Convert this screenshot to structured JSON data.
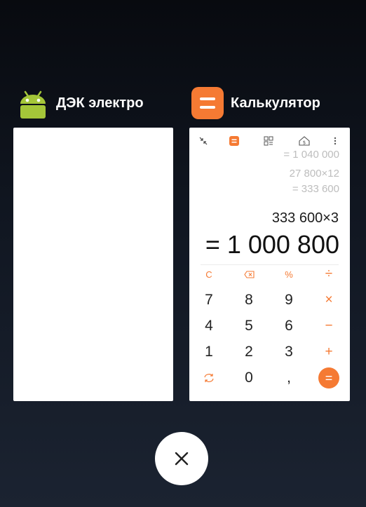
{
  "recents": [
    {
      "app_name": "ДЭК электро",
      "icon": "android-icon"
    },
    {
      "app_name": "Калькулятор",
      "icon": "calculator-icon",
      "calculator": {
        "toolbar": [
          "collapse-icon",
          "calculator-mode-icon",
          "converter-icon",
          "currency-icon",
          "more-icon"
        ],
        "history": [
          "= 1 040 000",
          "27 800×12",
          "= 333 600"
        ],
        "expression": "333 600×3",
        "result": "= 1 000 800",
        "keys": {
          "clear": "C",
          "backspace": "⌫",
          "percent": "%",
          "divide": "÷",
          "d7": "7",
          "d8": "8",
          "d9": "9",
          "multiply": "×",
          "d4": "4",
          "d5": "5",
          "d6": "6",
          "minus": "−",
          "d1": "1",
          "d2": "2",
          "d3": "3",
          "plus": "+",
          "swap": "swap-icon",
          "d0": "0",
          "comma": ",",
          "equals": "="
        }
      }
    }
  ],
  "accent_color": "#f57a33",
  "close_all_icon": "close-icon"
}
